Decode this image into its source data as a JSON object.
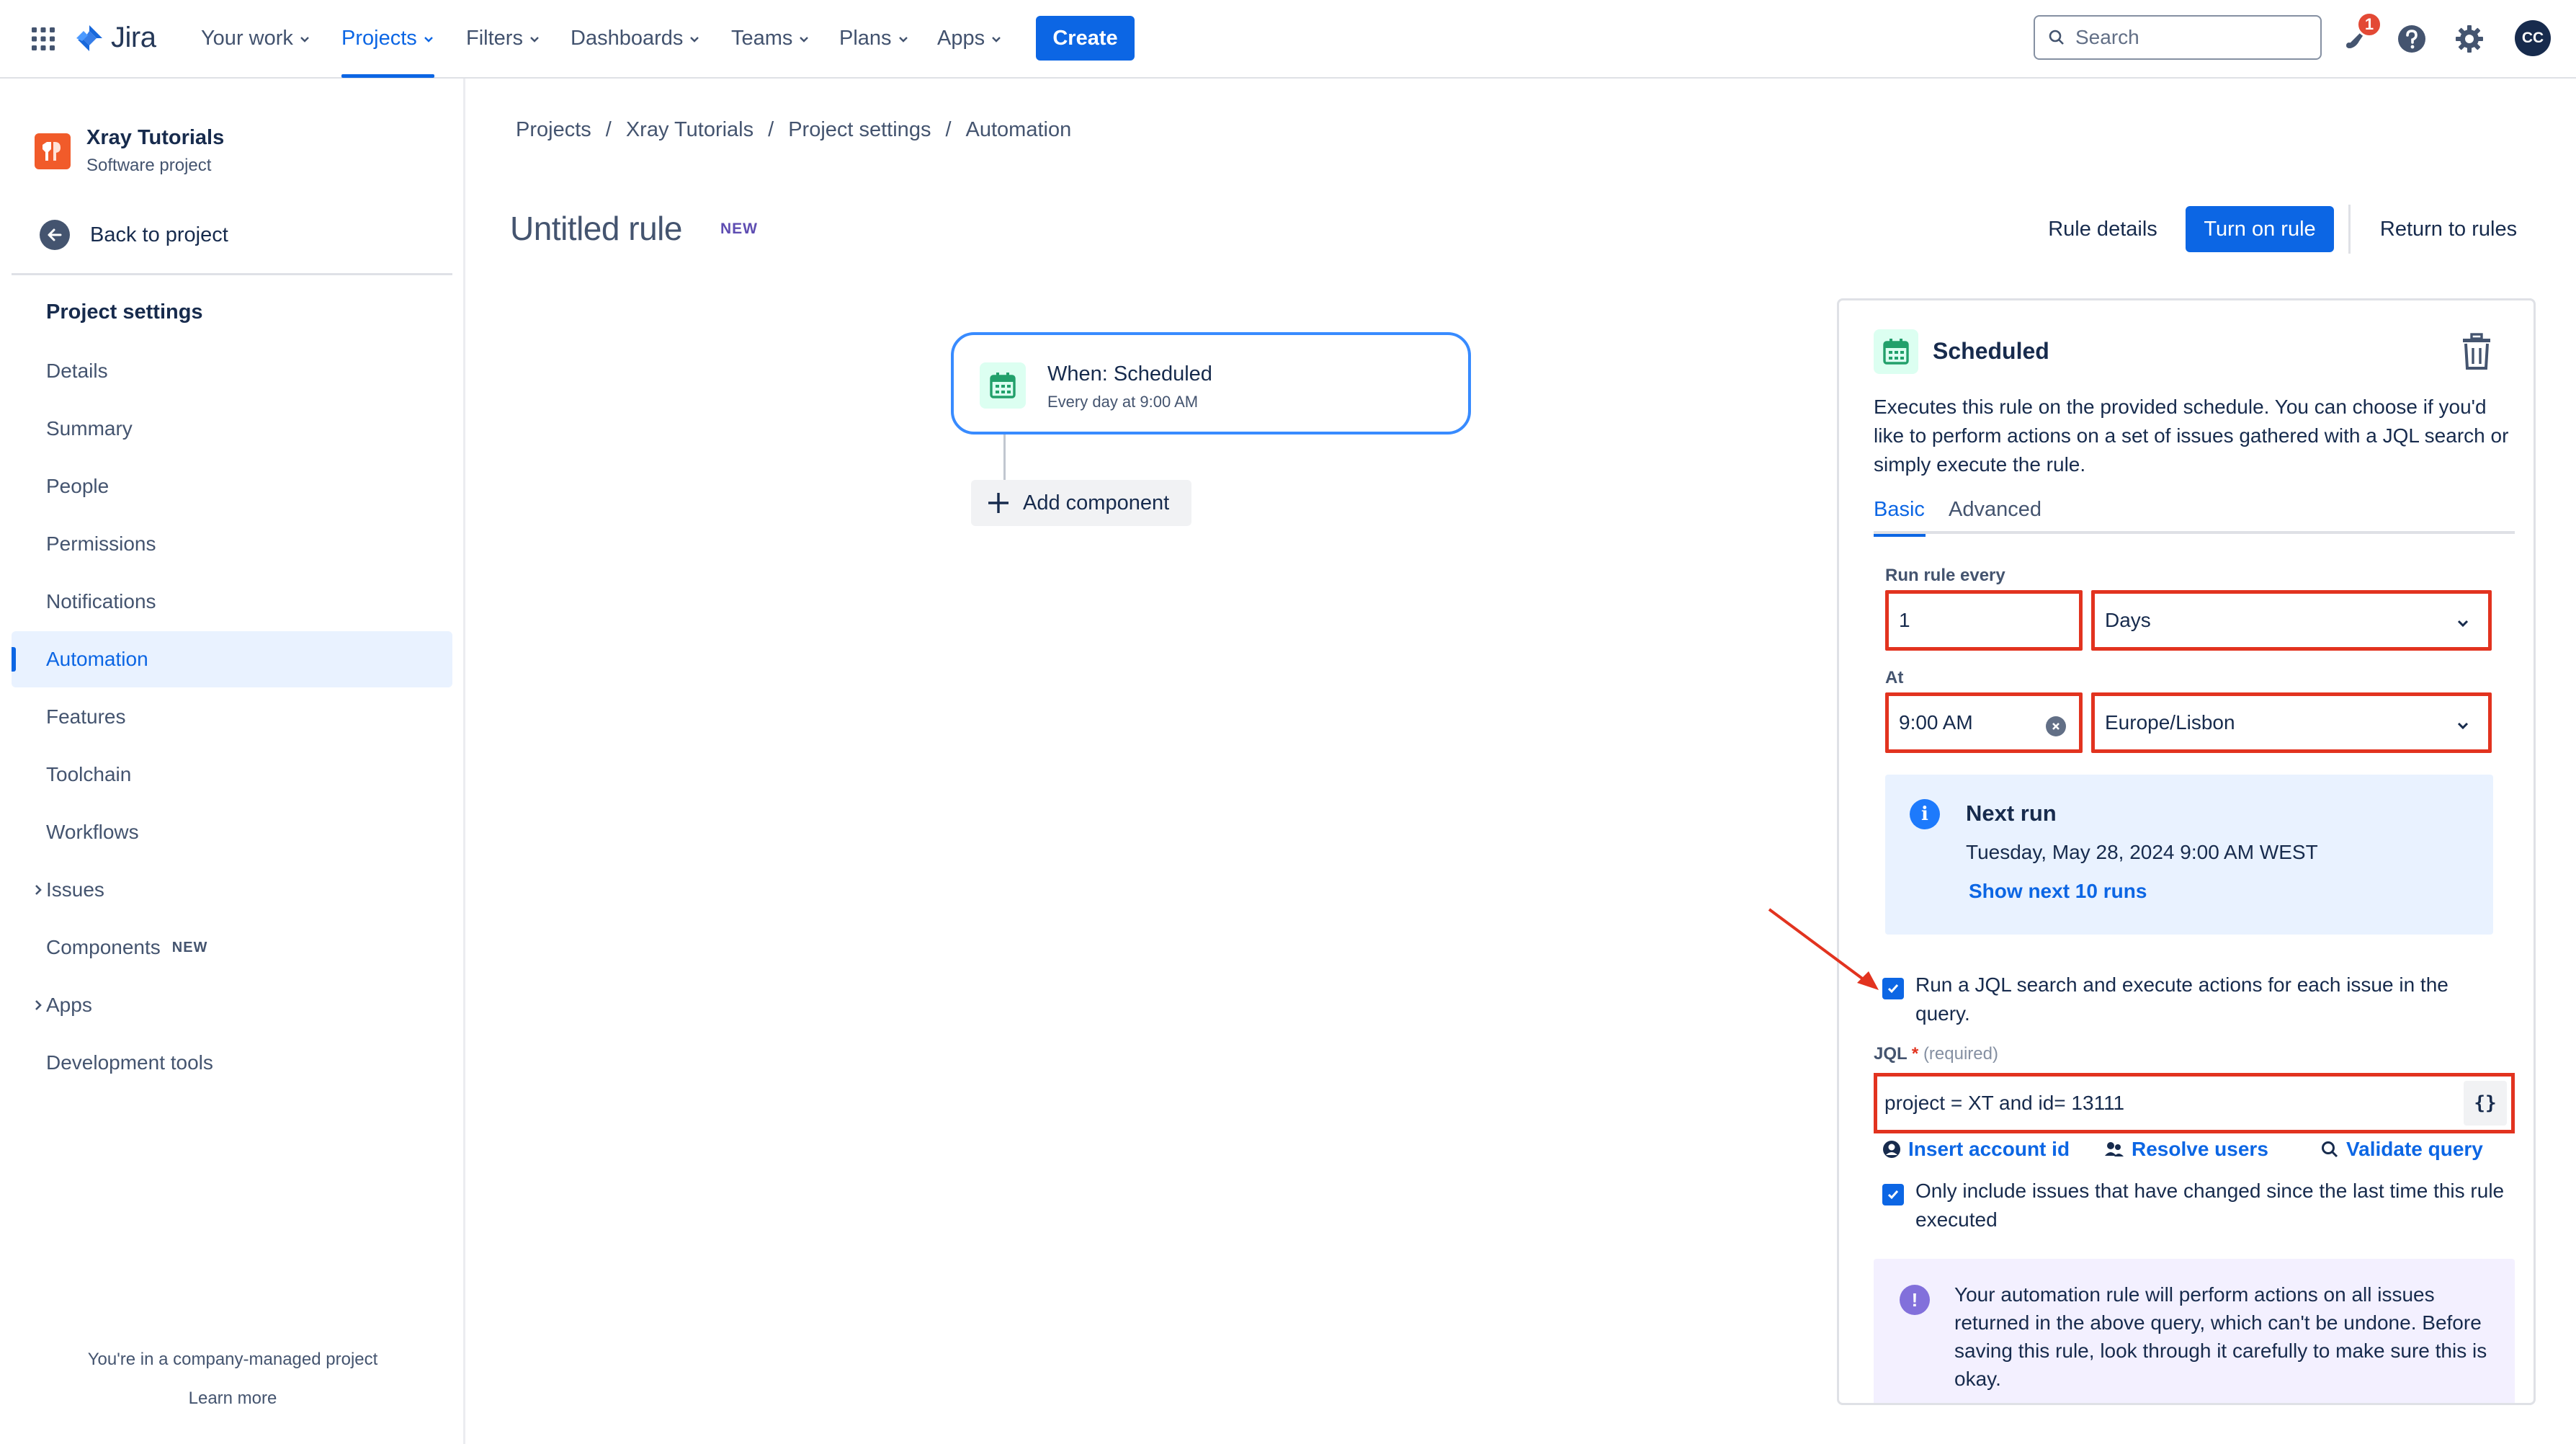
{
  "app": {
    "logo_text": "Jira"
  },
  "nav": {
    "items": [
      {
        "label": "Your work"
      },
      {
        "label": "Projects"
      },
      {
        "label": "Filters"
      },
      {
        "label": "Dashboards"
      },
      {
        "label": "Teams"
      },
      {
        "label": "Plans"
      },
      {
        "label": "Apps"
      }
    ],
    "active": "Projects",
    "create_label": "Create",
    "search_placeholder": "Search",
    "notification_count": "1",
    "avatar_initials": "CC"
  },
  "sidebar": {
    "project_name": "Xray Tutorials",
    "project_type": "Software project",
    "back_label": "Back to project",
    "heading": "Project settings",
    "items": [
      {
        "label": "Details"
      },
      {
        "label": "Summary"
      },
      {
        "label": "People"
      },
      {
        "label": "Permissions"
      },
      {
        "label": "Notifications"
      },
      {
        "label": "Automation"
      },
      {
        "label": "Features"
      },
      {
        "label": "Toolchain"
      },
      {
        "label": "Workflows"
      },
      {
        "label": "Issues"
      },
      {
        "label": "Components",
        "badge": "NEW"
      },
      {
        "label": "Apps"
      },
      {
        "label": "Development tools"
      }
    ],
    "active_item": "Automation",
    "footer_text": "You're in a company-managed project",
    "footer_link": "Learn more"
  },
  "breadcrumb": [
    "Projects",
    "Xray Tutorials",
    "Project settings",
    "Automation"
  ],
  "rule": {
    "title": "Untitled rule",
    "badge": "NEW",
    "details_label": "Rule details",
    "turn_on_label": "Turn on rule",
    "return_label": "Return to rules"
  },
  "flow": {
    "trigger_title": "When: Scheduled",
    "trigger_subtitle": "Every day at 9:00 AM",
    "add_component_label": "Add component"
  },
  "panel": {
    "title": "Scheduled",
    "description": "Executes this rule on the provided schedule. You can choose if you'd like to perform actions on a set of issues gathered with a JQL search or simply execute the rule.",
    "tabs": [
      {
        "label": "Basic"
      },
      {
        "label": "Advanced"
      }
    ],
    "active_tab": "Basic",
    "run_every_label": "Run rule every",
    "run_every_value": "1",
    "run_every_unit": "Days",
    "at_label": "At",
    "at_time": "9:00 AM",
    "timezone": "Europe/Lisbon",
    "next_run_title": "Next run",
    "next_run_date": "Tuesday, May 28, 2024 9:00 AM WEST",
    "next_run_link": "Show next 10 runs",
    "jql_checkbox_label": "Run a JQL search and execute actions for each issue in the query.",
    "jql_checkbox_checked": true,
    "jql_label": "JQL",
    "jql_required_star": "*",
    "jql_required_text": "(required)",
    "jql_value": "project = XT and id= 13111",
    "jql_braces": "{}",
    "insert_account_label": "Insert account id",
    "resolve_users_label": "Resolve users",
    "validate_label": "Validate query",
    "changed_checkbox_label": "Only include issues that have changed since the last time this rule executed",
    "changed_checkbox_checked": true,
    "warning_text": "Your automation rule will perform actions on all issues returned in the above query, which can't be undone. Before saving this rule, look through it carefully to make sure this is okay."
  },
  "colors": {
    "brand": "#0c66e4",
    "highlight": "#e2331f",
    "info_bg": "#e9f2ff",
    "warning_bg": "#f3f0ff"
  }
}
